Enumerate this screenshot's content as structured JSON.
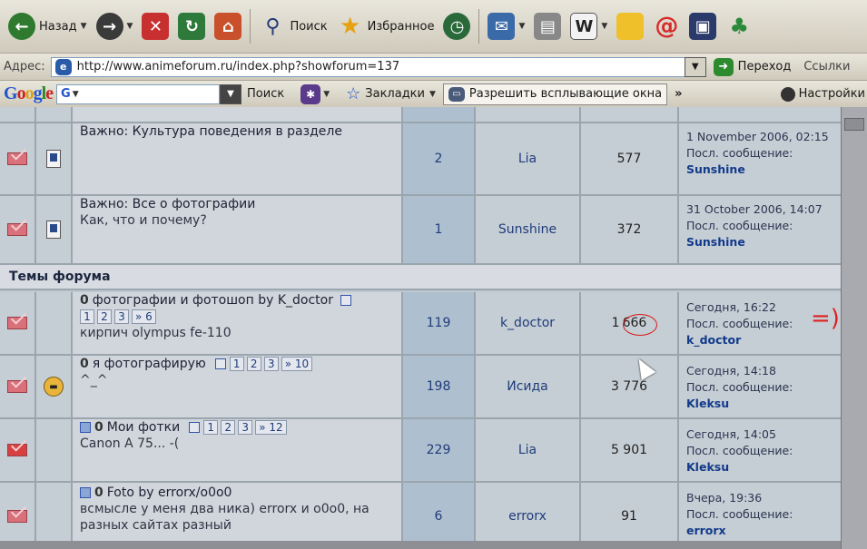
{
  "toolbar": {
    "back_label": "Назад",
    "search_label": "Поиск",
    "favorites_label": "Избранное"
  },
  "address": {
    "label": "Адрес:",
    "url": "http://www.animeforum.ru/index.php?showforum=137",
    "go_label": "Переход",
    "links_label": "Ссылки"
  },
  "google": {
    "logo": "Google",
    "g_label": "G",
    "search_label": "Поиск",
    "bookmarks_label": "Закладки",
    "popup_label": "Разрешить всплывающие окна",
    "more_label": "»",
    "settings_label": "Настройки"
  },
  "forum": {
    "pinned": [
      {
        "title": "Важно: Культура поведения в разделе",
        "desc": "",
        "replies": "2",
        "author": "Lia",
        "views": "577",
        "date": "1 November 2006, 02:15",
        "last_label": "Посл. сообщение:",
        "last_author": "Sunshine"
      },
      {
        "title": "Важно: Все о фотографии",
        "desc": "Как, что и почему?",
        "replies": "1",
        "author": "Sunshine",
        "views": "372",
        "date": "31 October 2006, 14:07",
        "last_label": "Посл. сообщение:",
        "last_author": "Sunshine"
      }
    ],
    "category": "Темы форума",
    "topics": [
      {
        "title": "фотографии и фотошоп by K_doctor",
        "pages": [
          "1",
          "2",
          "3",
          "» 6"
        ],
        "desc": "кирпич olympus fe-110",
        "replies": "119",
        "author": "k_doctor",
        "views_prefix": "1",
        "views_rest": "666",
        "date": "Сегодня, 16:22",
        "last_label": "Посл. сообщение:",
        "last_author": "k_doctor"
      },
      {
        "title": "я фотографирую",
        "pages": [
          "1",
          "2",
          "3",
          "» 10"
        ],
        "desc": "^_^",
        "replies": "198",
        "author": "Исида",
        "views": "3 776",
        "date": "Сегодня, 14:18",
        "last_label": "Посл. сообщение:",
        "last_author": "Kleksu"
      },
      {
        "title": "Мои фотки",
        "pages": [
          "1",
          "2",
          "3",
          "» 12"
        ],
        "desc": "Canon A 75... -(",
        "replies": "229",
        "author": "Lia",
        "views": "5 901",
        "date": "Сегодня, 14:05",
        "last_label": "Посл. сообщение:",
        "last_author": "Kleksu"
      },
      {
        "title": "Foto by errorx/o0o0",
        "desc": "всмысле у меня два ника) errorx и o0o0, на разных сайтах разный",
        "replies": "6",
        "author": "errorx",
        "views": "91",
        "date": "Вчера, 19:36",
        "last_label": "Посл. сообщение:",
        "last_author": "errorx"
      }
    ],
    "annotation": "=)"
  }
}
